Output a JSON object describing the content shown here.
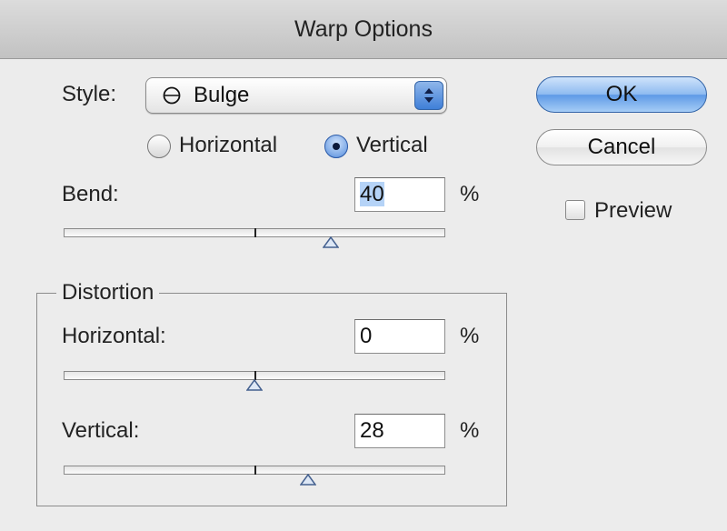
{
  "window": {
    "title": "Warp Options"
  },
  "style": {
    "label": "Style:",
    "selected": "Bulge",
    "icon": "bulge-shape-icon"
  },
  "orientation": {
    "horizontal_label": "Horizontal",
    "vertical_label": "Vertical",
    "selected": "Vertical"
  },
  "bend": {
    "label": "Bend:",
    "value": "40",
    "unit": "%",
    "slider_value_percent": 40
  },
  "distortion": {
    "group_title": "Distortion",
    "horizontal": {
      "label": "Horizontal:",
      "value": "0",
      "unit": "%",
      "slider_value_percent": 0
    },
    "vertical": {
      "label": "Vertical:",
      "value": "28",
      "unit": "%",
      "slider_value_percent": 28
    }
  },
  "buttons": {
    "ok": "OK",
    "cancel": "Cancel"
  },
  "preview": {
    "label": "Preview",
    "checked": false
  },
  "colors": {
    "accent": "#5d99e6",
    "text_selection": "#b5d3f7",
    "window_bg": "#ececec"
  }
}
